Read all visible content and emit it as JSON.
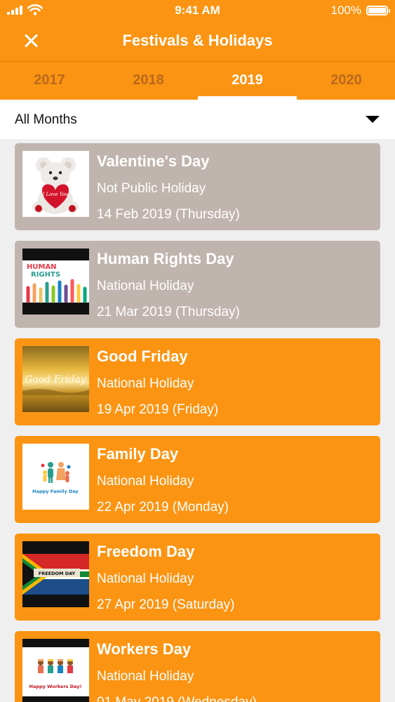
{
  "status_bar": {
    "time": "9:41 AM",
    "battery": "100%"
  },
  "header": {
    "title": "Festivals & Holidays"
  },
  "tabs": [
    {
      "label": "2017",
      "active": false
    },
    {
      "label": "2018",
      "active": false
    },
    {
      "label": "2019",
      "active": true
    },
    {
      "label": "2020",
      "active": false
    }
  ],
  "filter": {
    "selected": "All Months"
  },
  "holidays": [
    {
      "title": "Valentine's Day",
      "type": "Not Public Holiday",
      "date": "14 Feb 2019 (Thursday)",
      "style": "grey",
      "image_text": "I Love You",
      "icon": "teddy-bear-heart-image"
    },
    {
      "title": "Human Rights Day",
      "type": "National Holiday",
      "date": "21 Mar 2019 (Thursday)",
      "style": "grey",
      "image_text": [
        "HUMAN",
        "RIGHTS"
      ],
      "icon": "human-rights-hands-image"
    },
    {
      "title": "Good Friday",
      "type": "National Holiday",
      "date": "19 Apr 2019 (Friday)",
      "style": "orange",
      "image_text": "Good Friday",
      "icon": "good-friday-sunset-image"
    },
    {
      "title": "Family Day",
      "type": "National Holiday",
      "date": "22 Apr 2019 (Monday)",
      "style": "orange",
      "image_text": "Happy Family Day",
      "icon": "family-figures-image"
    },
    {
      "title": "Freedom Day",
      "type": "National Holiday",
      "date": "27 Apr 2019 (Saturday)",
      "style": "orange",
      "image_text": "FREEDOM DAY",
      "icon": "south-africa-flag-image"
    },
    {
      "title": "Workers Day",
      "type": "National Holiday",
      "date": "01 May 2019 (Wednesday)",
      "style": "orange",
      "image_text": "Happy Workers Day!",
      "icon": "workers-figures-image"
    }
  ],
  "colors": {
    "primary": "#fb9412",
    "past_card": "#c0b4ae",
    "tab_inactive": "#b9691d",
    "background": "#efefef"
  }
}
